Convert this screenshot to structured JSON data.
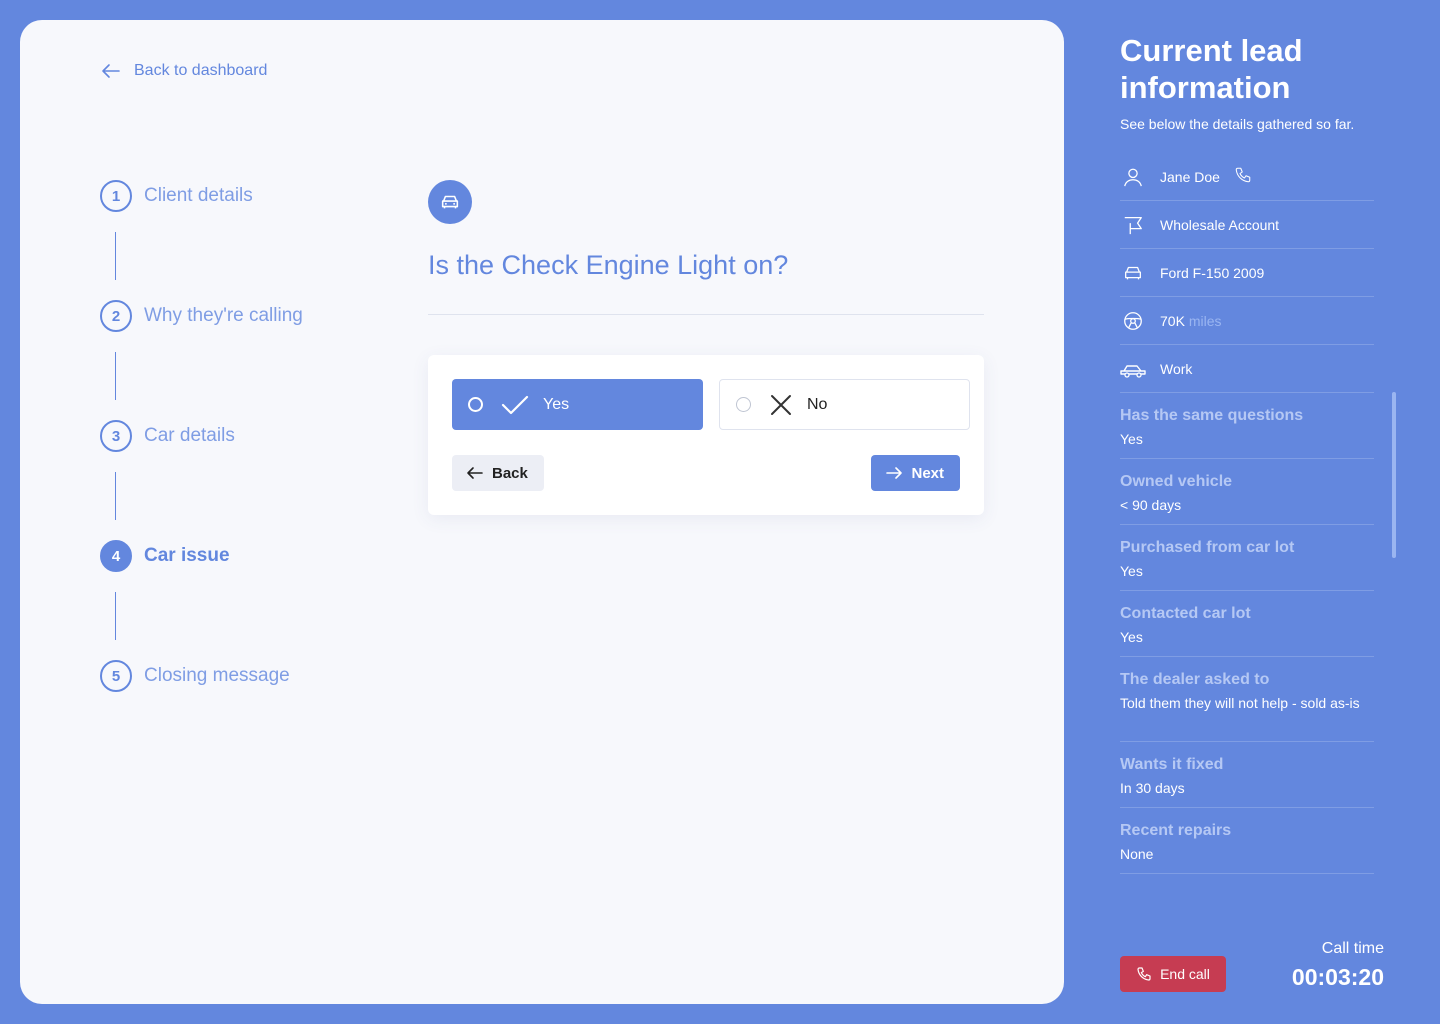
{
  "nav": {
    "back_label": "Back to dashboard"
  },
  "steps": [
    {
      "number": "1",
      "label": "Client details",
      "state": "default"
    },
    {
      "number": "2",
      "label": "Why they're calling",
      "state": "default"
    },
    {
      "number": "3",
      "label": "Car details",
      "state": "default"
    },
    {
      "number": "4",
      "label": "Car issue",
      "state": "active"
    },
    {
      "number": "5",
      "label": "Closing message",
      "state": "default"
    }
  ],
  "question": {
    "icon": "car-icon",
    "title": "Is the Check Engine Light on?",
    "options": [
      {
        "label": "Yes",
        "icon": "check-icon",
        "selected": true
      },
      {
        "label": "No",
        "icon": "x-icon",
        "selected": false
      }
    ],
    "back_label": "Back",
    "next_label": "Next"
  },
  "lead": {
    "title": "Current lead information",
    "subtitle": "See below the details gathered so far.",
    "info": [
      {
        "icon": "user-icon",
        "text": "Jane Doe",
        "extra_icon": "phone-icon"
      },
      {
        "icon": "flag-icon",
        "text": "Wholesale Account"
      },
      {
        "icon": "car-icon",
        "text": "Ford F-150 2009"
      },
      {
        "icon": "steering-wheel-icon",
        "text": "70K",
        "suffix": "miles"
      },
      {
        "icon": "car-side-icon",
        "text": "Work"
      }
    ],
    "answers": [
      {
        "question": "Has the same questions",
        "answer": "Yes"
      },
      {
        "question": "Owned vehicle",
        "answer": "<  90 days"
      },
      {
        "question": "Purchased from car lot",
        "answer": "Yes"
      },
      {
        "question": "Contacted car lot",
        "answer": "Yes"
      },
      {
        "question": "The dealer asked to",
        "answer": "Told them they will not help - sold as-is"
      },
      {
        "question": "Wants it fixed",
        "answer": "In 30 days"
      },
      {
        "question": "Recent repairs",
        "answer": "None"
      }
    ]
  },
  "call": {
    "end_label": "End call",
    "time_label": "Call time",
    "time": "00:03:20"
  },
  "colors": {
    "brand": "#6387de",
    "danger": "#c63c52",
    "background": "#f7f8fc"
  }
}
